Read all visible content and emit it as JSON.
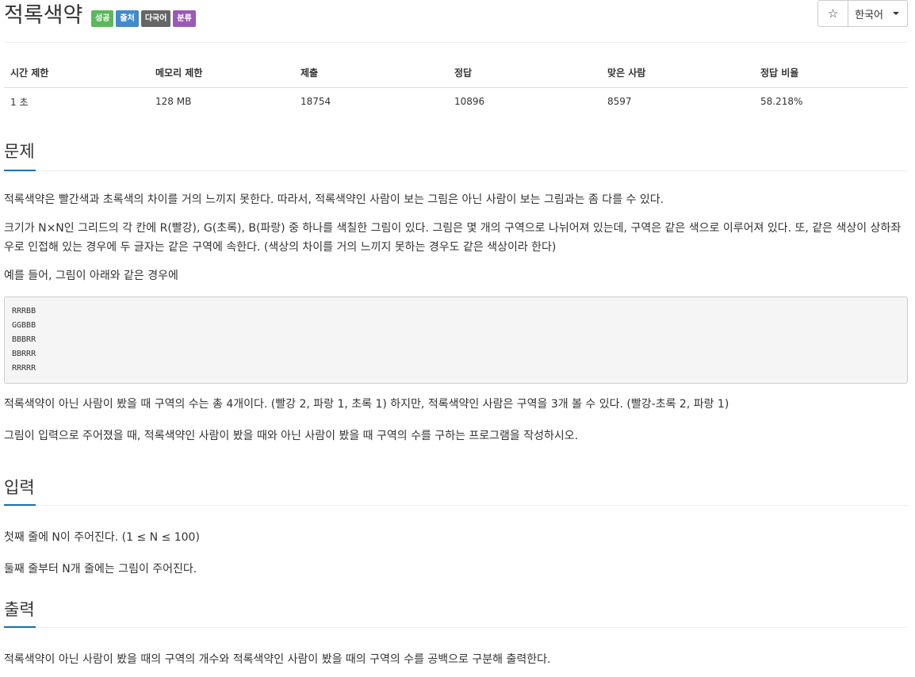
{
  "header": {
    "title": "적록색약",
    "labels": [
      {
        "text": "성공",
        "color": "#5cb85c"
      },
      {
        "text": "출처",
        "color": "#428bca"
      },
      {
        "text": "다국어",
        "color": "#666666"
      },
      {
        "text": "분류",
        "color": "#9b59b6"
      }
    ],
    "star_glyph": "☆",
    "language": "한국어"
  },
  "stats": {
    "headers": [
      "시간 제한",
      "메모리 제한",
      "제출",
      "정답",
      "맞은 사람",
      "정답 비율"
    ],
    "values": [
      "1 초",
      "128 MB",
      "18754",
      "10896",
      "8597",
      "58.218%"
    ]
  },
  "problem": {
    "heading": "문제",
    "p1": "적록색약은 빨간색과 초록색의 차이를 거의 느끼지 못한다. 따라서, 적록색약인 사람이 보는 그림은 아닌 사람이 보는 그림과는 좀 다를 수 있다.",
    "p2": "크기가 N×N인 그리드의 각 칸에 R(빨강), G(초록), B(파랑) 중 하나를 색칠한 그림이 있다. 그림은 몇 개의 구역으로 나뉘어져 있는데, 구역은 같은 색으로 이루어져 있다. 또, 같은 색상이 상하좌우로 인접해 있는 경우에 두 글자는 같은 구역에 속한다. (색상의 차이를 거의 느끼지 못하는 경우도 같은 색상이라 한다)",
    "p3": "예를 들어, 그림이 아래와 같은 경우에",
    "sample": [
      "RRRBB",
      "GGBBB",
      "BBBRR",
      "BBRRR",
      "RRRRR"
    ],
    "p4": "적록색약이 아닌 사람이 봤을 때 구역의 수는 총 4개이다. (빨강 2, 파랑 1, 초록 1) 하지만, 적록색약인 사람은 구역을 3개 볼 수 있다. (빨강-초록 2, 파랑 1)",
    "p5": "그림이 입력으로 주어졌을 때, 적록색약인 사람이 봤을 때와 아닌 사람이 봤을 때 구역의 수를 구하는 프로그램을 작성하시오."
  },
  "input": {
    "heading": "입력",
    "p1": "첫째 줄에 N이 주어진다. (1 ≤ N ≤ 100)",
    "p2": "둘째 줄부터 N개 줄에는 그림이 주어진다."
  },
  "output": {
    "heading": "출력",
    "p1": "적록색약이 아닌 사람이 봤을 때의 구역의 개수와 적록색약인 사람이 봤을 때의 구역의 수를 공백으로 구분해 출력한다."
  },
  "colors": {
    "accent": "#0f72b5"
  }
}
